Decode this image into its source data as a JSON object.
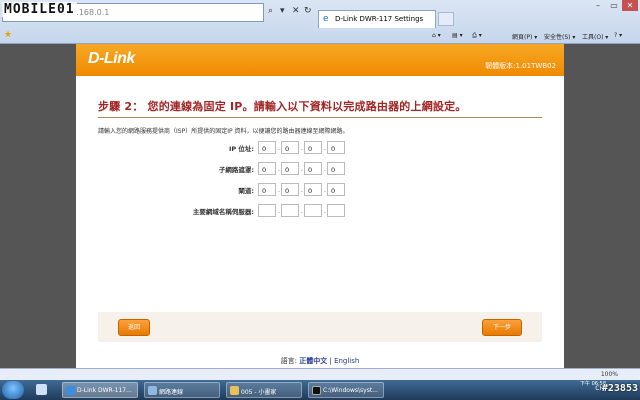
{
  "browser": {
    "watermark_logo": "MOBILE01",
    "address_text": "192.168.0.1",
    "tab_title": "D-Link DWR-117 Settings",
    "commands": {
      "page": "網頁(P) ▾",
      "safety": "安全性(S) ▾",
      "tools": "工具(O) ▾"
    },
    "zoom": "100%"
  },
  "router": {
    "brand": "D-Link",
    "firmware": "韌體版本:1.01TWB02",
    "step_title": "步驟 2： 您的連線為固定 IP。請輸入以下資料以完成路由器的上網設定。",
    "description": "請輸入您的網路服務提供商（ISP）所提供的固定IP 資料，以便讓您的路由器連線至網際網路。",
    "fields": [
      {
        "label": "IP 位址:",
        "octets": [
          "0",
          "0",
          "0",
          "0"
        ]
      },
      {
        "label": "子網路遮罩:",
        "octets": [
          "0",
          "0",
          "0",
          "0"
        ]
      },
      {
        "label": "閘道:",
        "octets": [
          "0",
          "0",
          "0",
          "0"
        ]
      },
      {
        "label": "主要網域名稱伺服器:",
        "octets": [
          "",
          "",
          "",
          ""
        ]
      }
    ],
    "back_label": "返回",
    "next_label": "下一步",
    "language_prefix": "語言:",
    "language_zh": "正體中文",
    "language_sep": "|",
    "language_en": "English"
  },
  "taskbar": {
    "tasks": [
      "D-Link DWR-117...",
      "網路連線",
      "005 - 小畫家",
      "C:\\Windows\\syst..."
    ],
    "tray_text": "CH",
    "clock": "下午 06:58",
    "watermark": "#23853"
  }
}
